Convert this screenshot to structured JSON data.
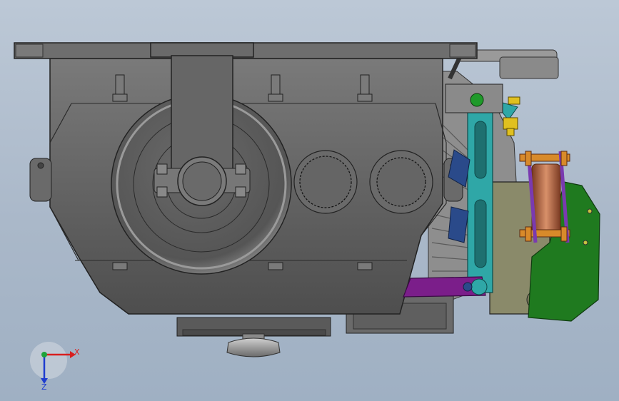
{
  "app": {
    "view": "cad-model-viewport"
  },
  "triad": {
    "x_label": "X",
    "z_label": "Z",
    "x_color": "#d81e1e",
    "y_color": "#1fa33a",
    "z_color": "#1e3ccf"
  },
  "colors": {
    "housing_dark": "#5a5a5a",
    "housing_mid": "#6f6f6f",
    "housing_light": "#8a8a8a",
    "bracket_teal": "#2fa7a7",
    "link_purple": "#7b1e8a",
    "cam_green": "#1f7a1f",
    "plate_olive": "#8a8a6a",
    "bolt_orange": "#d88a2a",
    "bolt_yellow": "#e0c020",
    "fitting_green": "#1f9a2a"
  }
}
